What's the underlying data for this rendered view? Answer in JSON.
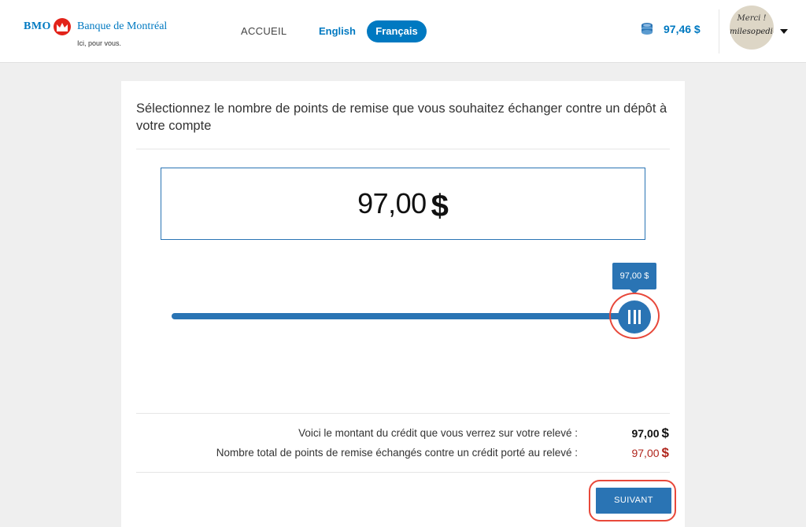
{
  "header": {
    "logo": {
      "brand": "BMO",
      "bank_name": "Banque de Montréal",
      "tagline": "Ici, pour vous.",
      "roundel_color": "#e2231a"
    },
    "nav": {
      "home": "ACCUEIL",
      "english": "English",
      "french": "Français"
    },
    "balance": {
      "icon": "coins-icon",
      "amount": "97,46 $"
    },
    "avatar": {
      "line1": "Merci !",
      "line2": "milesopedia"
    }
  },
  "main": {
    "title": "Sélectionnez le nombre de points de remise que vous souhaitez échanger contre un dépôt à votre compte",
    "amount": {
      "value": "97,00",
      "symbol": "$"
    },
    "slider": {
      "tooltip": "97,00 $",
      "level": 1.0
    },
    "summary": {
      "credit_label": "Voici le montant du crédit que vous verrez sur votre relevé :",
      "credit_value": "97,00",
      "points_label": "Nombre total de points de remise échangés contre un crédit porté au relevé :",
      "points_value": "97,00",
      "currency": "$"
    },
    "next_button": "SUIVANT"
  },
  "colors": {
    "brand_blue": "#0079c1",
    "slider_blue": "#2a74b4",
    "points_red": "#b0261d",
    "annotation_ring": "#e8483a"
  }
}
